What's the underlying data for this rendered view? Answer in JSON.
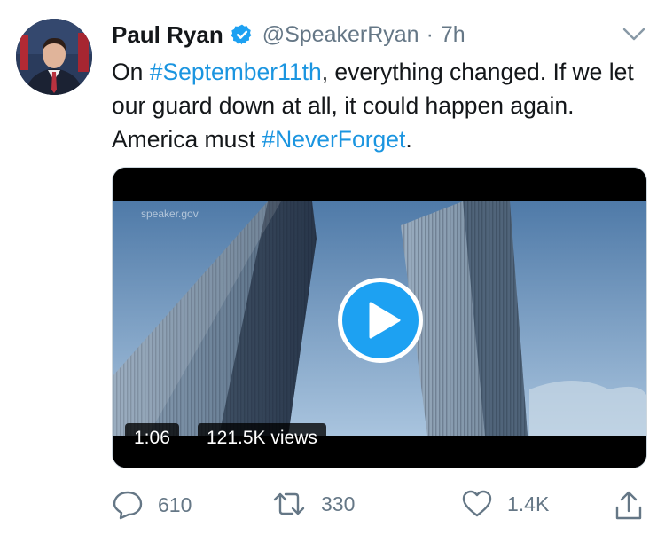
{
  "author": {
    "name": "Paul Ryan",
    "handle": "@SpeakerRyan",
    "separator": "·",
    "time": "7h",
    "verified": true
  },
  "tweet": {
    "text_1": "On ",
    "hashtag_1": "#September11th",
    "text_2": ", everything changed. If we let our guard down at all, it could happen again. America must ",
    "hashtag_2": "#NeverForget",
    "text_3": "."
  },
  "media": {
    "watermark": "speaker.gov",
    "duration": "1:06",
    "views": "121.5K views"
  },
  "actions": {
    "reply_count": "610",
    "retweet_count": "330",
    "like_count": "1.4K"
  },
  "colors": {
    "link": "#1b95e0",
    "accent": "#1da1f2",
    "muted": "#657786"
  },
  "icons": [
    "verified-badge-icon",
    "caret-down-icon",
    "play-icon",
    "reply-icon",
    "retweet-icon",
    "like-icon",
    "share-icon"
  ]
}
